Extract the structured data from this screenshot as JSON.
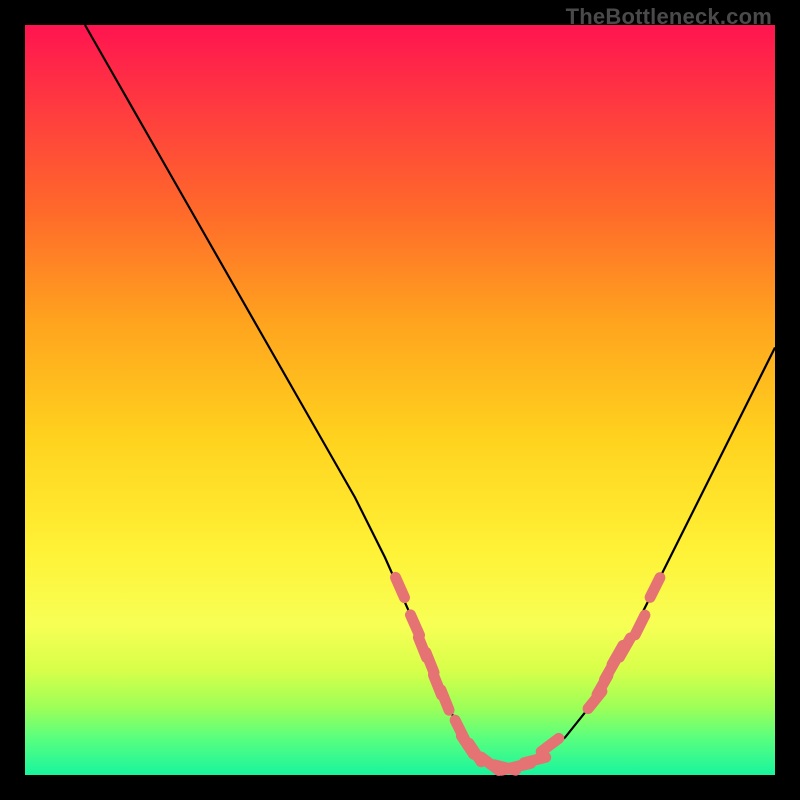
{
  "watermark": "TheBottleneck.com",
  "colors": {
    "curve": "#000000",
    "markers": "#e57373",
    "background_frame": "#000000"
  },
  "chart_data": {
    "type": "line",
    "title": "",
    "xlabel": "",
    "ylabel": "",
    "xlim": [
      0,
      100
    ],
    "ylim": [
      0,
      100
    ],
    "grid": false,
    "legend": false,
    "series": [
      {
        "name": "bottleneck-curve",
        "x": [
          8,
          12,
          16,
          20,
          24,
          28,
          32,
          36,
          40,
          44,
          48,
          52,
          54,
          56,
          58,
          60,
          62,
          64,
          68,
          72,
          76,
          80,
          84,
          88,
          92,
          96,
          100
        ],
        "y": [
          100,
          93,
          86,
          79,
          72,
          65,
          58,
          51,
          44,
          37,
          29,
          20,
          15,
          10,
          6,
          3,
          1.5,
          1,
          2,
          5,
          10,
          17,
          25,
          33,
          41,
          49,
          57
        ]
      }
    ],
    "markers": {
      "name": "highlighted-segment",
      "points": [
        {
          "x": 50,
          "y": 25
        },
        {
          "x": 52,
          "y": 20
        },
        {
          "x": 53,
          "y": 17
        },
        {
          "x": 54,
          "y": 15
        },
        {
          "x": 55,
          "y": 12
        },
        {
          "x": 56,
          "y": 10
        },
        {
          "x": 58,
          "y": 6
        },
        {
          "x": 59,
          "y": 4
        },
        {
          "x": 60,
          "y": 3
        },
        {
          "x": 62,
          "y": 1.5
        },
        {
          "x": 64,
          "y": 1
        },
        {
          "x": 65,
          "y": 1
        },
        {
          "x": 66,
          "y": 1.2
        },
        {
          "x": 68,
          "y": 2
        },
        {
          "x": 70,
          "y": 4
        },
        {
          "x": 76,
          "y": 10
        },
        {
          "x": 77,
          "y": 12
        },
        {
          "x": 78,
          "y": 14
        },
        {
          "x": 79,
          "y": 16
        },
        {
          "x": 80,
          "y": 17
        },
        {
          "x": 82,
          "y": 20
        },
        {
          "x": 84,
          "y": 25
        }
      ]
    }
  }
}
